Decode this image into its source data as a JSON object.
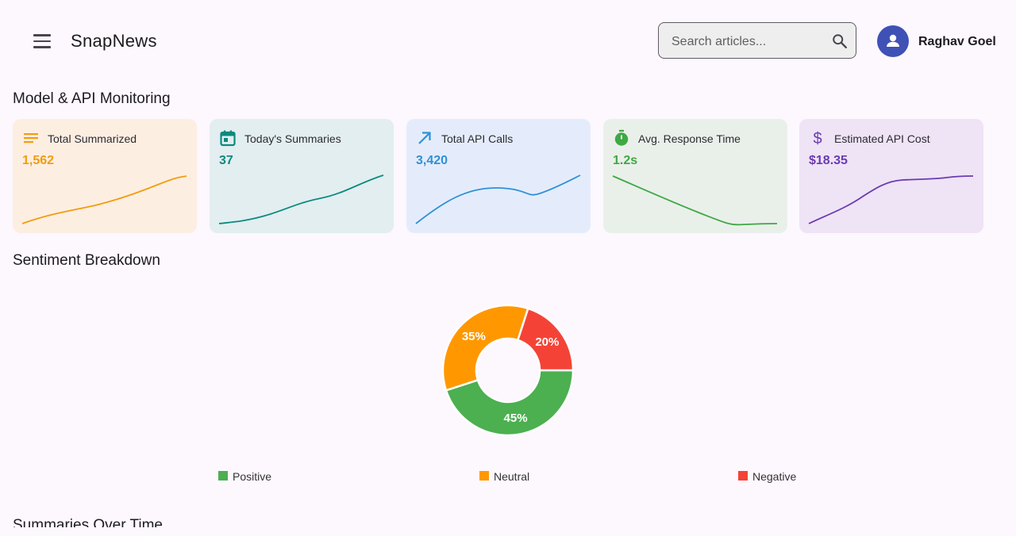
{
  "app": {
    "title": "SnapNews",
    "menu_icon": "menu-icon"
  },
  "search": {
    "placeholder": "Search articles...",
    "value": "",
    "icon": "search-icon"
  },
  "user": {
    "name": "Raghav Goel",
    "avatar_icon": "person-icon",
    "avatar_color": "#3f51b5"
  },
  "sections": {
    "monitoring": "Model & API Monitoring",
    "sentiment": "Sentiment Breakdown",
    "summaries": "Summaries Over Time"
  },
  "cards": [
    {
      "label": "Total Summarized",
      "value": "1,562",
      "icon": "notes-icon",
      "color": "#f29d0c",
      "bg": "#fdeee2"
    },
    {
      "label": "Today's Summaries",
      "value": "37",
      "icon": "calendar-icon",
      "color": "#0c8a7e",
      "bg": "#e2eef0"
    },
    {
      "label": "Total API Calls",
      "value": "3,420",
      "icon": "trending-arrow-icon",
      "color": "#2e91d6",
      "bg": "#e4ecfb"
    },
    {
      "label": "Avg. Response Time",
      "value": "1.2s",
      "icon": "timer-icon",
      "color": "#3fa843",
      "bg": "#e9f0ea"
    },
    {
      "label": "Estimated API Cost",
      "value": "$18.35",
      "icon": "dollar-icon",
      "color": "#6a3bb0",
      "bg": "#efe3f6"
    }
  ],
  "chart_data": {
    "type": "pie",
    "categories": [
      "Positive",
      "Neutral",
      "Negative"
    ],
    "values": [
      45,
      35,
      20
    ],
    "labels": [
      "45%",
      "35%",
      "20%"
    ],
    "colors": [
      "#4caf50",
      "#ff9800",
      "#f44336"
    ],
    "legend_position": "bottom",
    "style": "donut"
  }
}
